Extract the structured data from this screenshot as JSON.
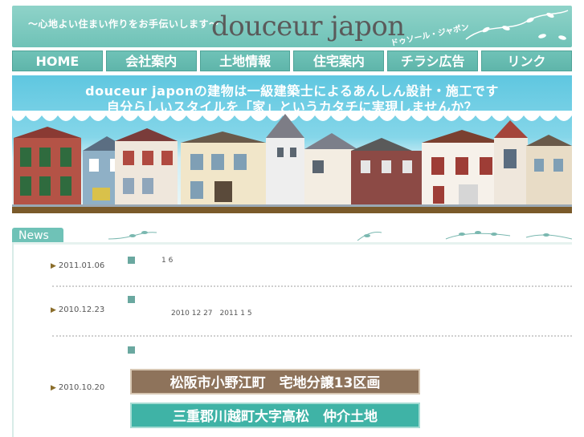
{
  "header": {
    "tagline": "〜心地よい住まい作りをお手伝いします〜",
    "logo": "douceur japon",
    "logo_kana": "ドゥソール・ジャポン"
  },
  "nav": {
    "items": [
      {
        "label": "HOME"
      },
      {
        "label": "会社案内"
      },
      {
        "label": "土地情報"
      },
      {
        "label": "住宅案内"
      },
      {
        "label": "チラシ広告"
      },
      {
        "label": "リンク"
      }
    ]
  },
  "hero": {
    "line1": "douceur japonの建物は一級建築士によるあんしん設計・施工です",
    "line2": "自分らしいスタイルを「家」というカタチに実現しませんか？"
  },
  "news": {
    "tab_label": "News",
    "items": [
      {
        "date": "2011.01.06",
        "text": "1 6"
      },
      {
        "date": "2010.12.23",
        "text": "2010 12 27　2011 1 5"
      },
      {
        "date": "2010.10.20",
        "badge1": "松阪市小野江町　宅地分譲13区画",
        "badge2": "三重郡川越町大字高松　仲介土地"
      }
    ]
  },
  "colors": {
    "teal": "#6fc2b7",
    "sky": "#5fc7e0",
    "brown": "#8e735b",
    "badge_teal": "#3fb3a6"
  }
}
